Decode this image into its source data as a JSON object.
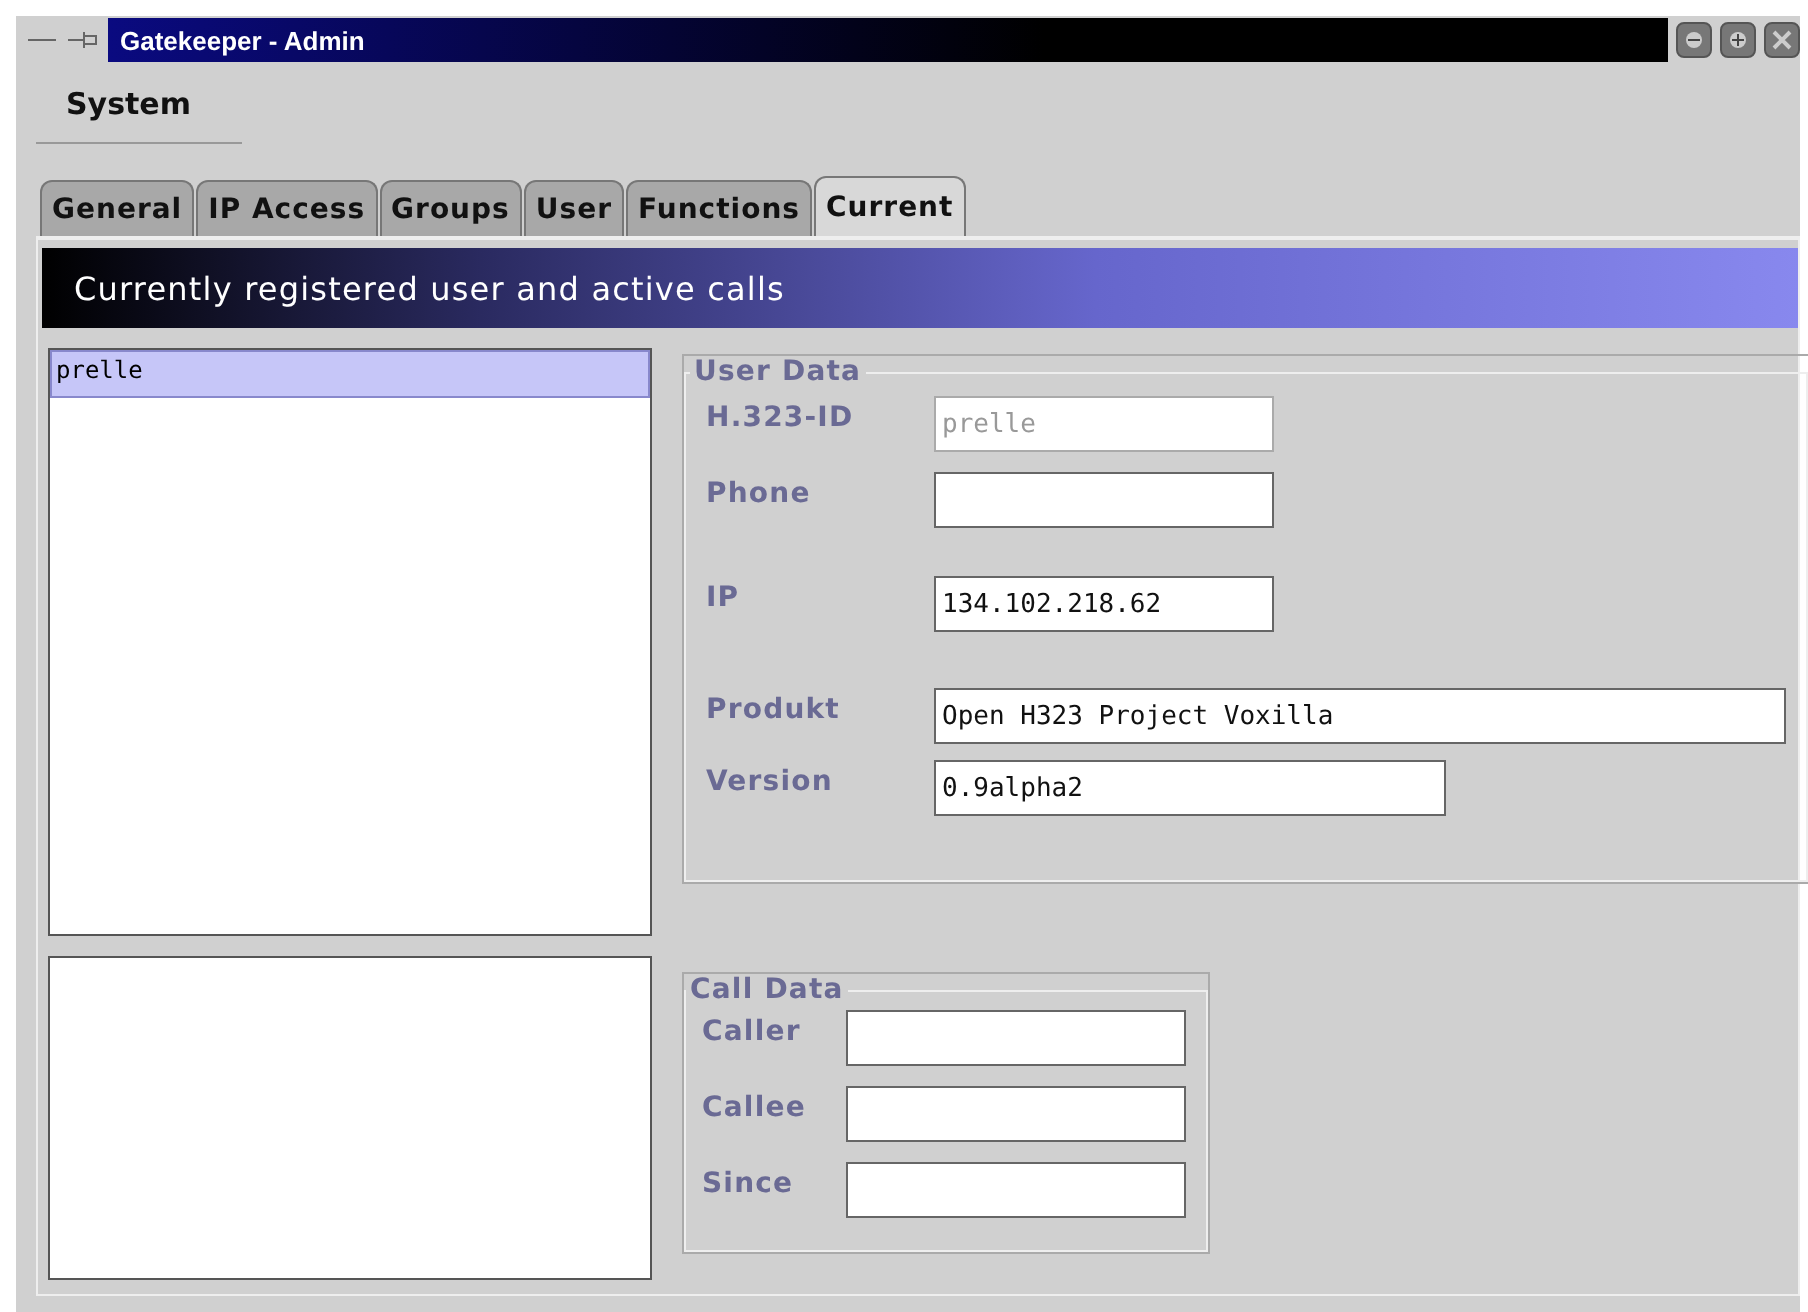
{
  "window": {
    "title": "Gatekeeper - Admin"
  },
  "menu": [
    "System"
  ],
  "tabs": [
    {
      "label": "General",
      "selected": false
    },
    {
      "label": "IP Access",
      "selected": false
    },
    {
      "label": "Groups",
      "selected": false
    },
    {
      "label": "User",
      "selected": false
    },
    {
      "label": "Functions",
      "selected": false
    },
    {
      "label": "Current",
      "selected": true
    }
  ],
  "header": "Currently registered user and active calls",
  "users": [
    {
      "name": "prelle",
      "selected": true
    }
  ],
  "user_data": {
    "title": "User Data",
    "fields": [
      {
        "label": "H.323-ID",
        "value": "prelle",
        "disabled": true
      },
      {
        "label": "Phone",
        "disabled": false
      },
      {
        "label": "IP",
        "value": "134.102.218.62",
        "disabled": false
      },
      {
        "label": "Produkt",
        "value": "Open H323 Project Voxilla",
        "disabled": false
      },
      {
        "label": "Version",
        "value": "0.9alpha2",
        "disabled": false
      }
    ]
  },
  "call_data": {
    "title": "Call Data",
    "fields": [
      {
        "label": "Caller"
      },
      {
        "label": "Callee"
      },
      {
        "label": "Since"
      }
    ]
  }
}
